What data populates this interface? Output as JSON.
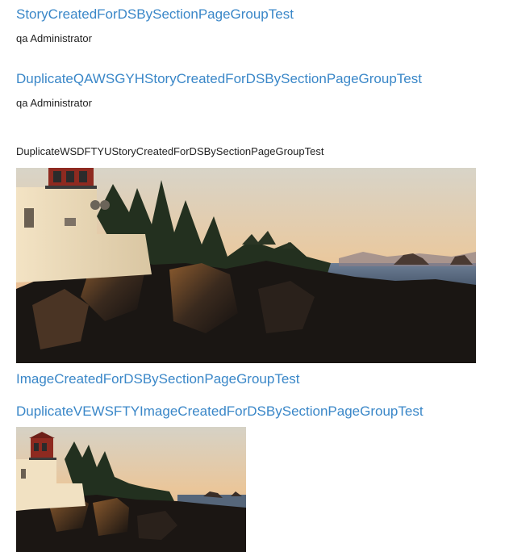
{
  "items": [
    {
      "title": "StoryCreatedForDSBySectionPageGroupTest",
      "author": "qa Administrator"
    },
    {
      "title": "DuplicateQAWSGYHStoryCreatedForDSBySectionPageGroupTest",
      "author": "qa Administrator"
    },
    {
      "title": "DuplicateWSDFTYUStoryCreatedForDSBySectionPageGroupTest",
      "image": "lighthouse-coast-photo"
    },
    {
      "title": "ImageCreatedForDSBySectionPageGroupTest"
    },
    {
      "title": "DuplicateVEWSFTYImageCreatedForDSBySectionPageGroupTest",
      "image": "lighthouse-coast-photo"
    }
  ],
  "colors": {
    "link": "#3a87c8",
    "text": "#222222",
    "background": "#ffffff"
  }
}
